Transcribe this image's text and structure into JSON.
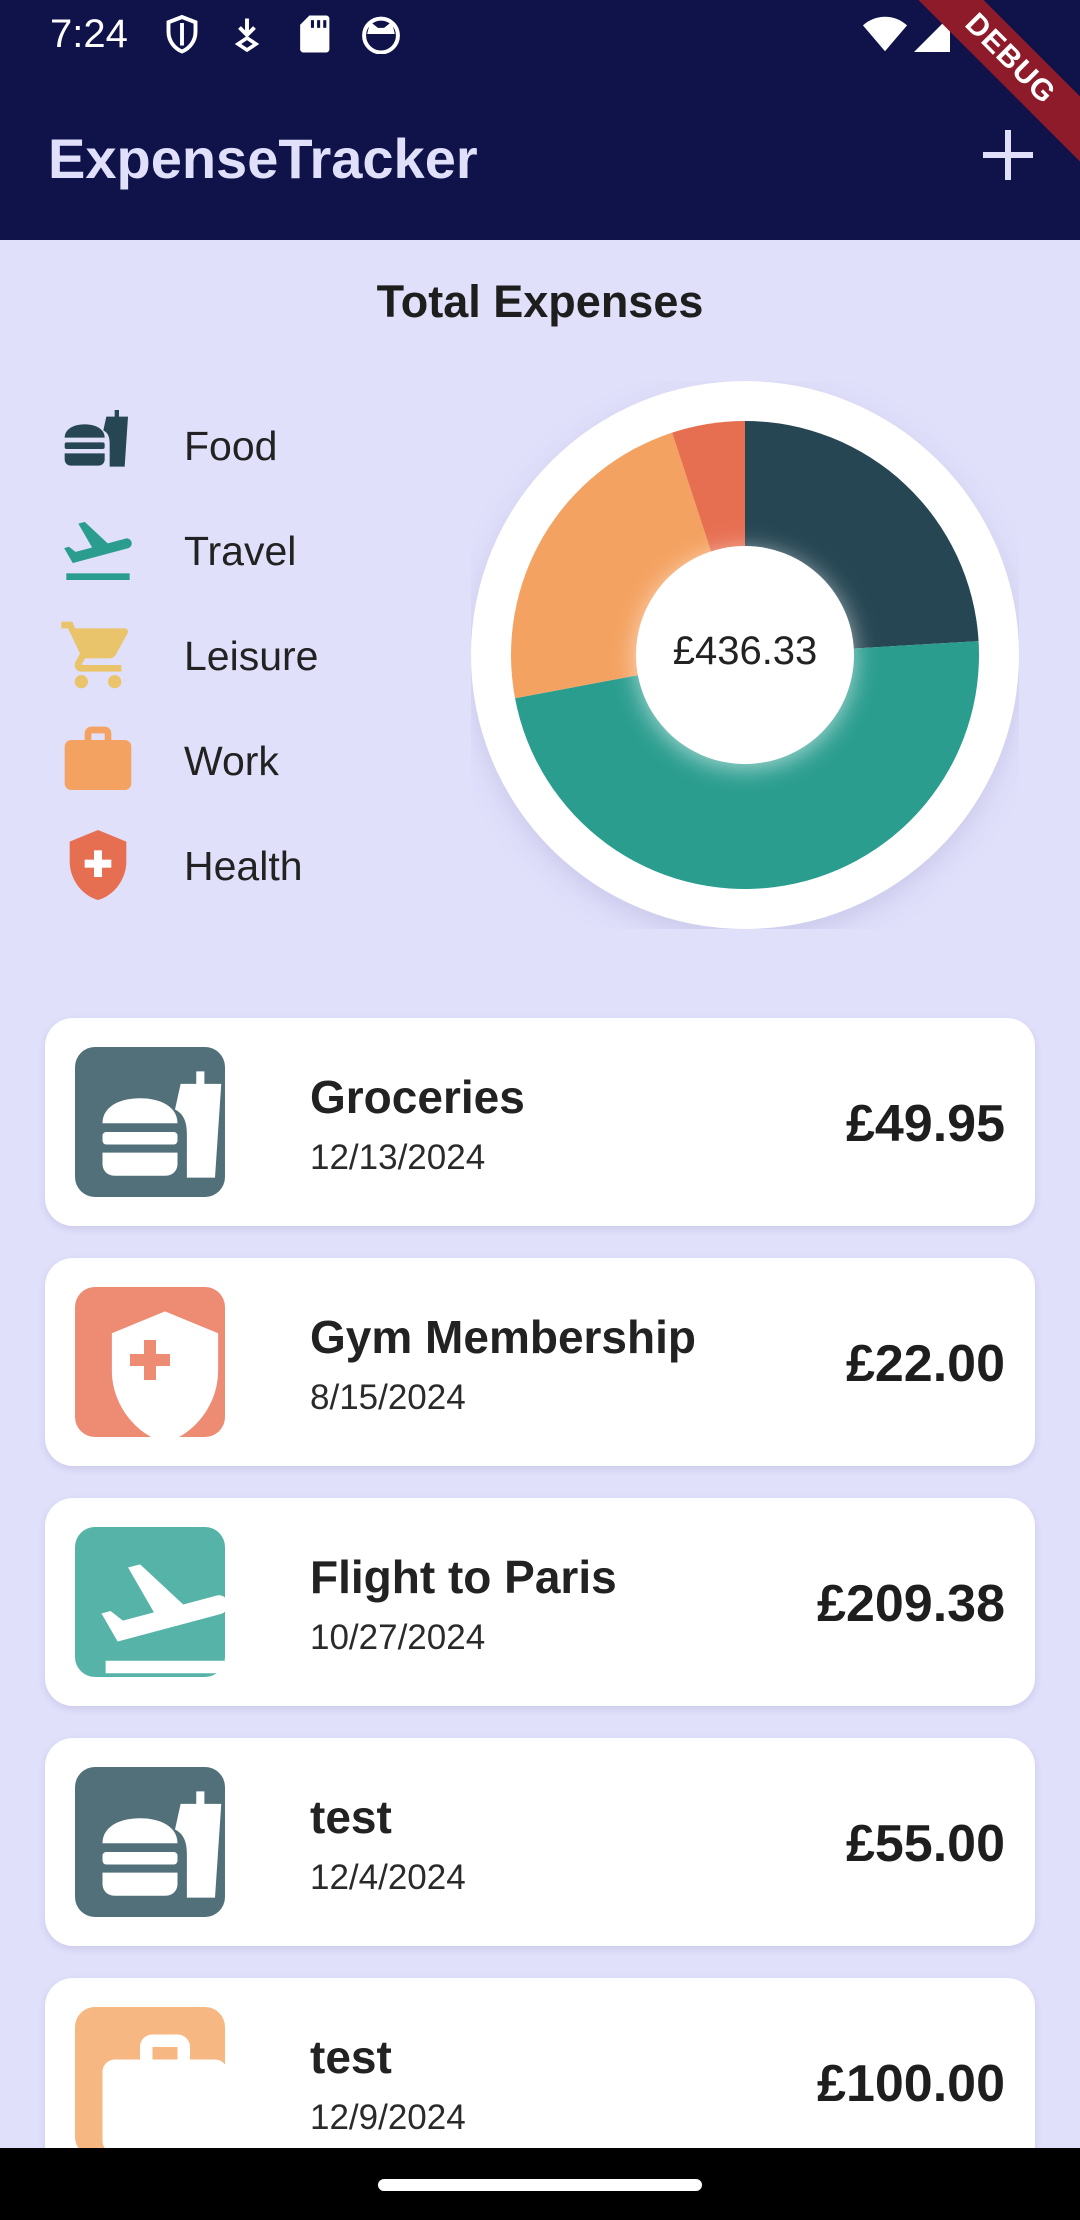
{
  "status_bar": {
    "time": "7:24",
    "icons": [
      "shield-icon",
      "download-icon",
      "sd-card-icon",
      "cat-face-icon",
      "wifi-icon",
      "cellular-signal-icon"
    ]
  },
  "debug_banner": "DEBUG",
  "app_bar": {
    "title": "ExpenseTracker",
    "action_icon": "plus-icon"
  },
  "summary": {
    "title": "Total Expenses",
    "total": "£436.33"
  },
  "categories": [
    {
      "label": "Food",
      "icon": "food-icon",
      "color": "#264653"
    },
    {
      "label": "Travel",
      "icon": "flight-icon",
      "color": "#2a9d8f"
    },
    {
      "label": "Leisure",
      "icon": "shopping-cart-icon",
      "color": "#e9c46a"
    },
    {
      "label": "Work",
      "icon": "briefcase-icon",
      "color": "#f4a261"
    },
    {
      "label": "Health",
      "icon": "health-shield-icon",
      "color": "#e76f51"
    }
  ],
  "chart_data": {
    "type": "pie",
    "categories": [
      "Food",
      "Travel",
      "Leisure",
      "Work",
      "Health"
    ],
    "values": [
      104.95,
      209.38,
      0,
      100.0,
      22.0
    ],
    "colors": [
      "#264653",
      "#2a9d8f",
      "#e9c46a",
      "#f4a261",
      "#e76f51"
    ],
    "center_label": "£436.33"
  },
  "expenses": [
    {
      "name": "Groceries",
      "date": "12/13/2024",
      "amount": "£49.95",
      "category": "Food",
      "icon": "food-icon",
      "color": "#52707a"
    },
    {
      "name": "Gym Membership",
      "date": "8/15/2024",
      "amount": "£22.00",
      "category": "Health",
      "icon": "health-shield-icon",
      "color": "#ed8b73"
    },
    {
      "name": "Flight to Paris",
      "date": "10/27/2024",
      "amount": "£209.38",
      "category": "Travel",
      "icon": "flight-icon",
      "color": "#55b3a8"
    },
    {
      "name": "test",
      "date": "12/4/2024",
      "amount": "£55.00",
      "category": "Food",
      "icon": "food-icon",
      "color": "#52707a"
    },
    {
      "name": "test",
      "date": "12/9/2024",
      "amount": "£100.00",
      "category": "Work",
      "icon": "briefcase-icon",
      "color": "#f6b782"
    }
  ]
}
